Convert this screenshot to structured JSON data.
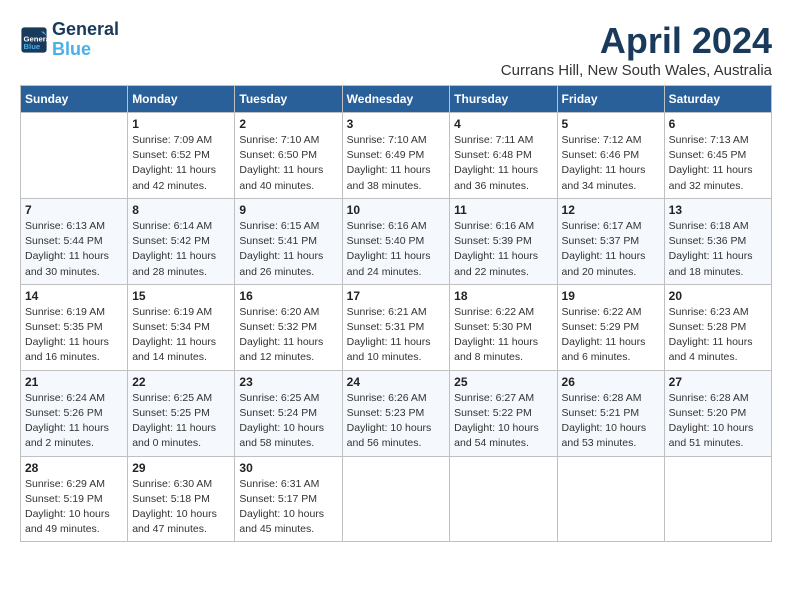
{
  "header": {
    "logo_line1": "General",
    "logo_line2": "Blue",
    "month": "April 2024",
    "location": "Currans Hill, New South Wales, Australia"
  },
  "weekdays": [
    "Sunday",
    "Monday",
    "Tuesday",
    "Wednesday",
    "Thursday",
    "Friday",
    "Saturday"
  ],
  "weeks": [
    [
      {
        "day": "",
        "info": ""
      },
      {
        "day": "1",
        "info": "Sunrise: 7:09 AM\nSunset: 6:52 PM\nDaylight: 11 hours\nand 42 minutes."
      },
      {
        "day": "2",
        "info": "Sunrise: 7:10 AM\nSunset: 6:50 PM\nDaylight: 11 hours\nand 40 minutes."
      },
      {
        "day": "3",
        "info": "Sunrise: 7:10 AM\nSunset: 6:49 PM\nDaylight: 11 hours\nand 38 minutes."
      },
      {
        "day": "4",
        "info": "Sunrise: 7:11 AM\nSunset: 6:48 PM\nDaylight: 11 hours\nand 36 minutes."
      },
      {
        "day": "5",
        "info": "Sunrise: 7:12 AM\nSunset: 6:46 PM\nDaylight: 11 hours\nand 34 minutes."
      },
      {
        "day": "6",
        "info": "Sunrise: 7:13 AM\nSunset: 6:45 PM\nDaylight: 11 hours\nand 32 minutes."
      }
    ],
    [
      {
        "day": "7",
        "info": "Sunrise: 6:13 AM\nSunset: 5:44 PM\nDaylight: 11 hours\nand 30 minutes."
      },
      {
        "day": "8",
        "info": "Sunrise: 6:14 AM\nSunset: 5:42 PM\nDaylight: 11 hours\nand 28 minutes."
      },
      {
        "day": "9",
        "info": "Sunrise: 6:15 AM\nSunset: 5:41 PM\nDaylight: 11 hours\nand 26 minutes."
      },
      {
        "day": "10",
        "info": "Sunrise: 6:16 AM\nSunset: 5:40 PM\nDaylight: 11 hours\nand 24 minutes."
      },
      {
        "day": "11",
        "info": "Sunrise: 6:16 AM\nSunset: 5:39 PM\nDaylight: 11 hours\nand 22 minutes."
      },
      {
        "day": "12",
        "info": "Sunrise: 6:17 AM\nSunset: 5:37 PM\nDaylight: 11 hours\nand 20 minutes."
      },
      {
        "day": "13",
        "info": "Sunrise: 6:18 AM\nSunset: 5:36 PM\nDaylight: 11 hours\nand 18 minutes."
      }
    ],
    [
      {
        "day": "14",
        "info": "Sunrise: 6:19 AM\nSunset: 5:35 PM\nDaylight: 11 hours\nand 16 minutes."
      },
      {
        "day": "15",
        "info": "Sunrise: 6:19 AM\nSunset: 5:34 PM\nDaylight: 11 hours\nand 14 minutes."
      },
      {
        "day": "16",
        "info": "Sunrise: 6:20 AM\nSunset: 5:32 PM\nDaylight: 11 hours\nand 12 minutes."
      },
      {
        "day": "17",
        "info": "Sunrise: 6:21 AM\nSunset: 5:31 PM\nDaylight: 11 hours\nand 10 minutes."
      },
      {
        "day": "18",
        "info": "Sunrise: 6:22 AM\nSunset: 5:30 PM\nDaylight: 11 hours\nand 8 minutes."
      },
      {
        "day": "19",
        "info": "Sunrise: 6:22 AM\nSunset: 5:29 PM\nDaylight: 11 hours\nand 6 minutes."
      },
      {
        "day": "20",
        "info": "Sunrise: 6:23 AM\nSunset: 5:28 PM\nDaylight: 11 hours\nand 4 minutes."
      }
    ],
    [
      {
        "day": "21",
        "info": "Sunrise: 6:24 AM\nSunset: 5:26 PM\nDaylight: 11 hours\nand 2 minutes."
      },
      {
        "day": "22",
        "info": "Sunrise: 6:25 AM\nSunset: 5:25 PM\nDaylight: 11 hours\nand 0 minutes."
      },
      {
        "day": "23",
        "info": "Sunrise: 6:25 AM\nSunset: 5:24 PM\nDaylight: 10 hours\nand 58 minutes."
      },
      {
        "day": "24",
        "info": "Sunrise: 6:26 AM\nSunset: 5:23 PM\nDaylight: 10 hours\nand 56 minutes."
      },
      {
        "day": "25",
        "info": "Sunrise: 6:27 AM\nSunset: 5:22 PM\nDaylight: 10 hours\nand 54 minutes."
      },
      {
        "day": "26",
        "info": "Sunrise: 6:28 AM\nSunset: 5:21 PM\nDaylight: 10 hours\nand 53 minutes."
      },
      {
        "day": "27",
        "info": "Sunrise: 6:28 AM\nSunset: 5:20 PM\nDaylight: 10 hours\nand 51 minutes."
      }
    ],
    [
      {
        "day": "28",
        "info": "Sunrise: 6:29 AM\nSunset: 5:19 PM\nDaylight: 10 hours\nand 49 minutes."
      },
      {
        "day": "29",
        "info": "Sunrise: 6:30 AM\nSunset: 5:18 PM\nDaylight: 10 hours\nand 47 minutes."
      },
      {
        "day": "30",
        "info": "Sunrise: 6:31 AM\nSunset: 5:17 PM\nDaylight: 10 hours\nand 45 minutes."
      },
      {
        "day": "",
        "info": ""
      },
      {
        "day": "",
        "info": ""
      },
      {
        "day": "",
        "info": ""
      },
      {
        "day": "",
        "info": ""
      }
    ]
  ]
}
